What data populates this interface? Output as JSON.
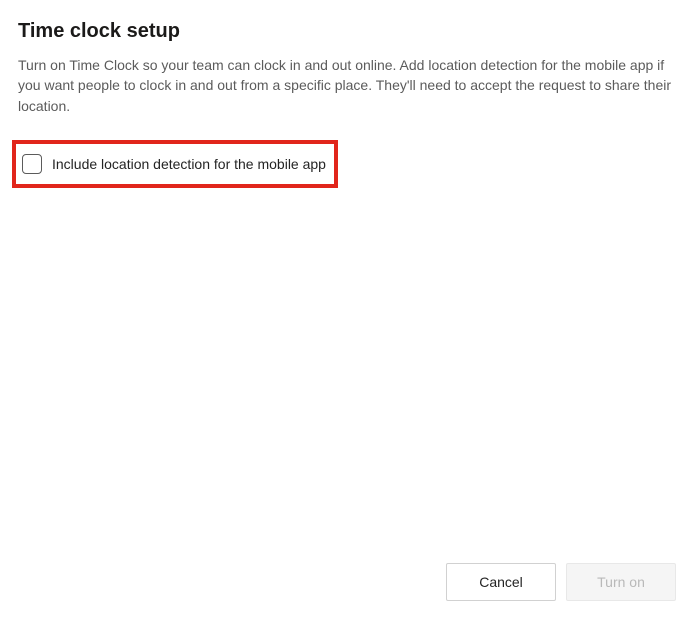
{
  "title": "Time clock setup",
  "description": "Turn on Time Clock so your team can clock in and out online. Add location detection for the mobile app if you want people to clock in and out from a specific place. They'll need to accept the request to share their location.",
  "checkbox": {
    "label": "Include location detection for the mobile app",
    "checked": false
  },
  "buttons": {
    "cancel": "Cancel",
    "turnOn": "Turn on"
  }
}
